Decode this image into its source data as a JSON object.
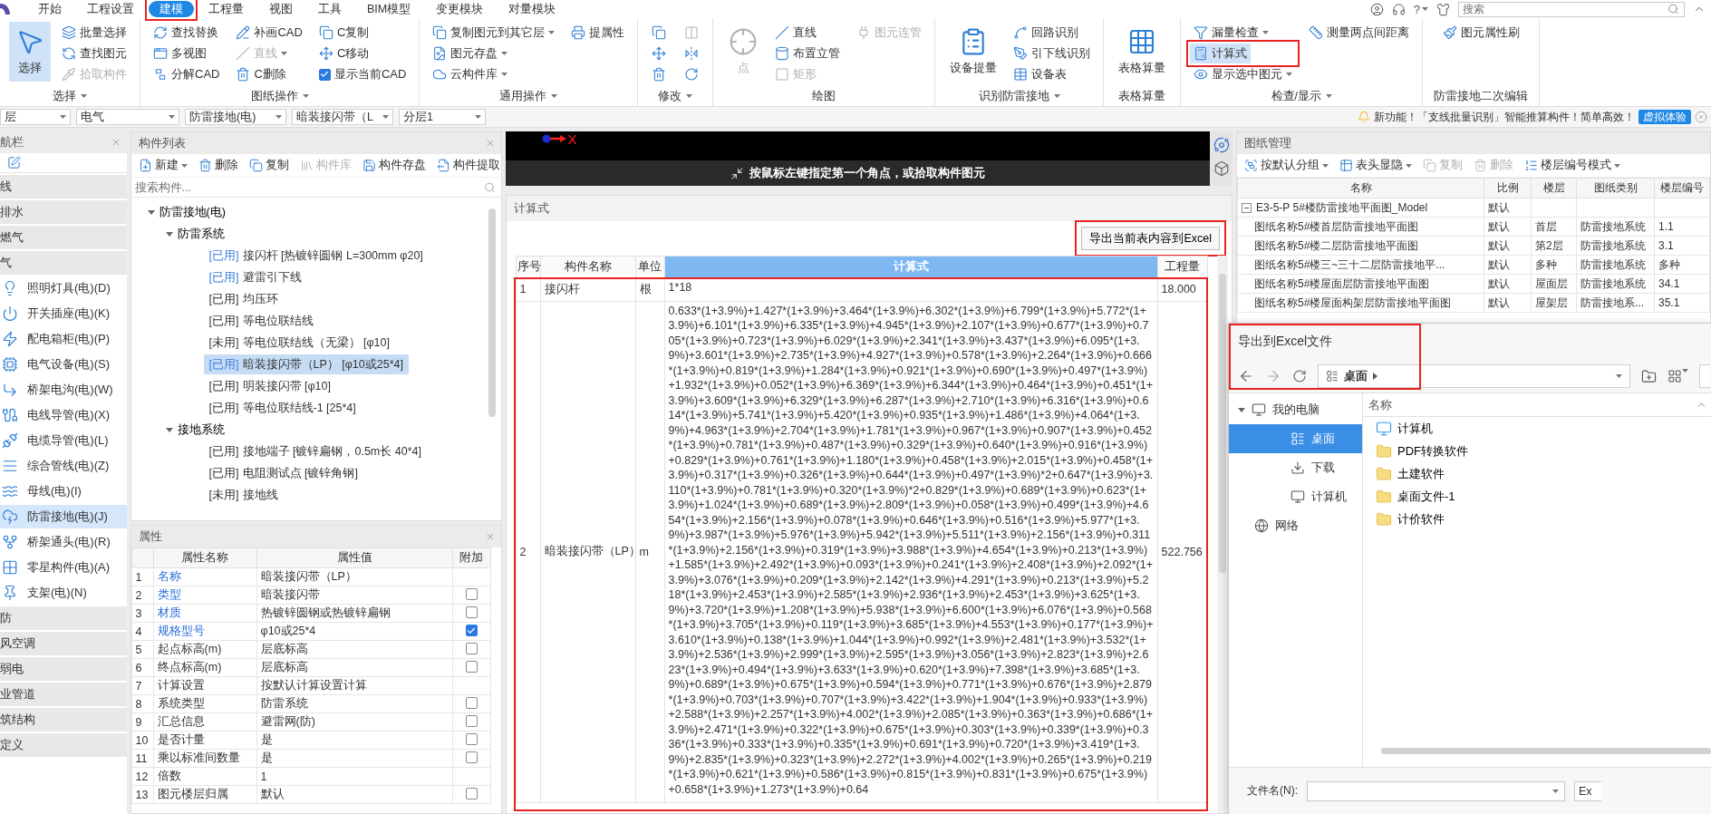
{
  "menu_bar": {
    "tabs": [
      {
        "label": "开始",
        "selected": false
      },
      {
        "label": "工程设置",
        "selected": false
      },
      {
        "label": "建模",
        "selected": true
      },
      {
        "label": "工程量",
        "selected": false
      },
      {
        "label": "视图",
        "selected": false
      },
      {
        "label": "工具",
        "selected": false
      },
      {
        "label": "BIM模型",
        "selected": false
      },
      {
        "label": "变更模块",
        "selected": false
      },
      {
        "label": "对量模块",
        "selected": false
      }
    ],
    "help": "?",
    "search": {
      "placeholder": "搜索"
    }
  },
  "ribbon": {
    "groups": [
      {
        "label": "选择",
        "menu": true,
        "items": [
          {
            "kind": "large",
            "label": "选择",
            "disabled": false,
            "dropdown": false,
            "active": true
          },
          {
            "kind": "small",
            "label": "批量选择",
            "disabled": false,
            "dropdown": false,
            "active": false
          },
          {
            "kind": "small",
            "label": "查找图元",
            "disabled": false,
            "dropdown": false,
            "active": false
          },
          {
            "kind": "small",
            "label": "拾取构件",
            "disabled": true,
            "dropdown": false,
            "active": false
          }
        ]
      },
      {
        "label": "图纸操作",
        "menu": true,
        "items": [
          {
            "kind": "small",
            "label": "查找替换",
            "disabled": false,
            "dropdown": false,
            "active": false
          },
          {
            "kind": "small",
            "label": "多视图",
            "disabled": false,
            "dropdown": false,
            "active": false
          },
          {
            "kind": "small",
            "label": "分解CAD",
            "disabled": false,
            "dropdown": false,
            "active": false
          },
          {
            "kind": "small",
            "label": "补画CAD",
            "disabled": false,
            "dropdown": false,
            "active": false
          },
          {
            "kind": "small",
            "label": "直线",
            "disabled": true,
            "dropdown": true,
            "active": false
          },
          {
            "kind": "small",
            "label": "C删除",
            "disabled": false,
            "dropdown": false,
            "active": false
          },
          {
            "kind": "small",
            "label": "C复制",
            "disabled": false,
            "dropdown": false,
            "active": false
          },
          {
            "kind": "small",
            "label": "C移动",
            "disabled": false,
            "dropdown": false,
            "active": false
          },
          {
            "kind": "check",
            "label": "显示当前CAD",
            "checked": true,
            "disabled": false,
            "dropdown": false,
            "active": false
          }
        ]
      },
      {
        "label": "通用操作",
        "menu": true,
        "items": [
          {
            "kind": "small",
            "label": "复制图元到其它层",
            "disabled": false,
            "dropdown": true,
            "active": false
          },
          {
            "kind": "small",
            "label": "图元存盘",
            "disabled": false,
            "dropdown": true,
            "active": false
          },
          {
            "kind": "small",
            "label": "云构件库",
            "disabled": false,
            "dropdown": true,
            "active": false
          },
          {
            "kind": "small",
            "label": "提属性",
            "disabled": false,
            "dropdown": false,
            "active": false
          }
        ]
      },
      {
        "label": "修改",
        "menu": true,
        "items": [
          {
            "kind": "icon",
            "disabled": false,
            "dropdown": false,
            "active": false
          },
          {
            "kind": "icon",
            "disabled": false,
            "dropdown": false,
            "active": false
          },
          {
            "kind": "icon",
            "disabled": false,
            "dropdown": false,
            "active": false
          },
          {
            "kind": "icon",
            "disabled": true,
            "dropdown": false,
            "active": false
          },
          {
            "kind": "icon",
            "disabled": false,
            "dropdown": false,
            "active": false
          },
          {
            "kind": "icon",
            "disabled": false,
            "dropdown": false,
            "active": false
          }
        ]
      },
      {
        "label": "绘图",
        "menu": false,
        "items": [
          {
            "kind": "large",
            "label": "点",
            "disabled": true,
            "dropdown": false,
            "active": false
          },
          {
            "kind": "small",
            "label": "直线",
            "disabled": false,
            "dropdown": false,
            "active": false
          },
          {
            "kind": "small",
            "label": "布置立管",
            "disabled": false,
            "dropdown": false,
            "active": false
          },
          {
            "kind": "small",
            "label": "矩形",
            "disabled": true,
            "dropdown": false,
            "active": false
          },
          {
            "kind": "small",
            "label": "图元连管",
            "disabled": true,
            "dropdown": false,
            "active": false
          }
        ]
      },
      {
        "label": "识别防雷接地",
        "menu": true,
        "items": [
          {
            "kind": "large",
            "label": "设备提量",
            "disabled": false,
            "dropdown": false,
            "active": false
          },
          {
            "kind": "small",
            "label": "回路识别",
            "disabled": false,
            "dropdown": false,
            "active": false
          },
          {
            "kind": "small",
            "label": "引下线识别",
            "disabled": false,
            "dropdown": false,
            "active": false
          },
          {
            "kind": "small",
            "label": "设备表",
            "disabled": false,
            "dropdown": false,
            "active": false
          }
        ]
      },
      {
        "label": "表格算量",
        "menu": false,
        "items": [
          {
            "kind": "large",
            "label": "表格算量",
            "disabled": false,
            "dropdown": false,
            "active": false
          }
        ]
      },
      {
        "label": "检查/显示",
        "menu": true,
        "items": [
          {
            "kind": "small",
            "label": "漏量检查",
            "disabled": false,
            "dropdown": true,
            "active": false
          },
          {
            "kind": "small",
            "label": "计算式",
            "disabled": false,
            "dropdown": false,
            "active": true
          },
          {
            "kind": "small",
            "label": "显示选中图元",
            "disabled": false,
            "dropdown": true,
            "active": false
          },
          {
            "kind": "small",
            "label": "测量两点间距离",
            "disabled": false,
            "dropdown": false,
            "active": false
          }
        ]
      },
      {
        "label": "防雷接地二次编辑",
        "menu": false,
        "items": [
          {
            "kind": "small",
            "label": "图元属性刷",
            "disabled": false,
            "dropdown": false,
            "active": false
          }
        ]
      }
    ]
  },
  "context_bar": {
    "dropdowns": [
      "层",
      "电气",
      "防雷接地(电)",
      "暗装接闪带（L",
      "分层1"
    ],
    "notice": "新功能！「支线批量识别」智能推算构件！简单高效！",
    "notice_button": "虚拟体验"
  },
  "nav_panel": {
    "title": "航栏",
    "items": [
      {
        "kind": "category",
        "label": "线",
        "selected": false
      },
      {
        "kind": "category",
        "label": "排水",
        "selected": false
      },
      {
        "kind": "category",
        "label": "燃气",
        "selected": false
      },
      {
        "kind": "category",
        "label": "气",
        "selected": false
      },
      {
        "kind": "item",
        "label": "照明灯具(电)(D)",
        "selected": false
      },
      {
        "kind": "item",
        "label": "开关插座(电)(K)",
        "selected": false
      },
      {
        "kind": "item",
        "label": "配电箱柜(电)(P)",
        "selected": false
      },
      {
        "kind": "item",
        "label": "电气设备(电)(S)",
        "selected": false
      },
      {
        "kind": "item",
        "label": "桥架电沟(电)(W)",
        "selected": false
      },
      {
        "kind": "item",
        "label": "电线导管(电)(X)",
        "selected": false
      },
      {
        "kind": "item",
        "label": "电缆导管(电)(L)",
        "selected": false
      },
      {
        "kind": "item",
        "label": "综合管线(电)(Z)",
        "selected": false
      },
      {
        "kind": "item",
        "label": "母线(电)(I)",
        "selected": false
      },
      {
        "kind": "item",
        "label": "防雷接地(电)(J)",
        "selected": true
      },
      {
        "kind": "item",
        "label": "桥架通头(电)(R)",
        "selected": false
      },
      {
        "kind": "item",
        "label": "零星构件(电)(A)",
        "selected": false
      },
      {
        "kind": "item",
        "label": "支架(电)(N)",
        "selected": false
      },
      {
        "kind": "category",
        "label": "防",
        "selected": false
      },
      {
        "kind": "category",
        "label": "风空调",
        "selected": false
      },
      {
        "kind": "category",
        "label": "弱电",
        "selected": false
      },
      {
        "kind": "category",
        "label": "业管道",
        "selected": false
      },
      {
        "kind": "category",
        "label": "筑结构",
        "selected": false
      },
      {
        "kind": "category",
        "label": "定义",
        "selected": false
      }
    ]
  },
  "component_list": {
    "title": "构件列表",
    "toolbar": [
      {
        "label": "新建",
        "disabled": false,
        "dropdown": true
      },
      {
        "label": "删除",
        "disabled": false,
        "dropdown": false
      },
      {
        "label": "复制",
        "disabled": false,
        "dropdown": false
      },
      {
        "label": "构件库",
        "disabled": true,
        "dropdown": false
      },
      {
        "label": "构件存盘",
        "disabled": false,
        "dropdown": false
      },
      {
        "label": "构件提取",
        "disabled": false,
        "dropdown": false
      }
    ],
    "search": {
      "placeholder": "搜索构件..."
    },
    "tree": [
      {
        "label": "防雷接地(电)",
        "expanded": true,
        "children": [
          {
            "label": "防雷系统",
            "expanded": true,
            "children": [
              {
                "tag": "[已用]",
                "label": "接闪杆 [热镀锌圆钢 L=300mm φ20]",
                "color": "#3b7ddd",
                "selected": false
              },
              {
                "tag": "[已用]",
                "label": "避雷引下线",
                "color": "#3b7ddd",
                "selected": false
              },
              {
                "tag": "[已用]",
                "label": "均压环",
                "color": "#333333",
                "selected": false
              },
              {
                "tag": "[已用]",
                "label": "等电位联结线",
                "color": "#333333",
                "selected": false
              },
              {
                "tag": "[未用]",
                "label": "等电位联结线（无梁） [φ10]",
                "color": "#333333",
                "selected": false
              },
              {
                "tag": "[已用]",
                "label": "暗装接闪带（LP） [φ10或25*4]",
                "color": "#3b7ddd",
                "selected": true
              },
              {
                "tag": "[已用]",
                "label": "明装接闪带 [φ10]",
                "color": "#333333",
                "selected": false
              },
              {
                "tag": "[已用]",
                "label": "等电位联结线-1 [25*4]",
                "color": "#333333",
                "selected": false
              }
            ]
          },
          {
            "label": "接地系统",
            "expanded": true,
            "children": [
              {
                "tag": "[已用]",
                "label": "接地端子 [镀锌扁钢，0.5m长 40*4]",
                "color": "#333333",
                "selected": false
              },
              {
                "tag": "[已用]",
                "label": "电阻测试点 [镀锌角钢]",
                "color": "#333333",
                "selected": false
              },
              {
                "tag": "[未用]",
                "label": "接地线",
                "color": "#333333",
                "selected": false
              }
            ]
          }
        ]
      }
    ]
  },
  "properties": {
    "title": "属性",
    "columns": [
      "属性名称",
      "属性值",
      "附加"
    ],
    "rows": [
      {
        "index": "1",
        "name": "名称",
        "value": "暗装接闪带（LP）",
        "highlighted": true,
        "kind": "plain"
      },
      {
        "index": "2",
        "name": "类型",
        "value": "暗装接闪带",
        "highlighted": true,
        "kind": "check",
        "checked": false
      },
      {
        "index": "3",
        "name": "材质",
        "value": "热镀锌圆钢或热镀锌扁钢",
        "highlighted": true,
        "kind": "check",
        "checked": false
      },
      {
        "index": "4",
        "name": "规格型号",
        "value": "φ10或25*4",
        "highlighted": true,
        "kind": "check",
        "checked": true
      },
      {
        "index": "5",
        "name": "起点标高(m)",
        "value": "层底标高",
        "highlighted": false,
        "kind": "check",
        "checked": false
      },
      {
        "index": "6",
        "name": "终点标高(m)",
        "value": "层底标高",
        "highlighted": false,
        "kind": "check",
        "checked": false
      },
      {
        "index": "7",
        "name": "计算设置",
        "value": "按默认计算设置计算",
        "highlighted": false,
        "kind": "plain"
      },
      {
        "index": "8",
        "name": "系统类型",
        "value": "防雷系统",
        "highlighted": false,
        "kind": "check",
        "checked": false
      },
      {
        "index": "9",
        "name": "汇总信息",
        "value": "避雷网(防)",
        "highlighted": false,
        "kind": "check",
        "checked": false
      },
      {
        "index": "10",
        "name": "是否计量",
        "value": "是",
        "highlighted": false,
        "kind": "check",
        "checked": false
      },
      {
        "index": "11",
        "name": "乘以标准间数量",
        "value": "是",
        "highlighted": false,
        "kind": "check",
        "checked": false
      },
      {
        "index": "12",
        "name": "倍数",
        "value": "1",
        "highlighted": false,
        "kind": "plain"
      },
      {
        "index": "13",
        "name": "图元楼层归属",
        "value": "默认",
        "highlighted": false,
        "kind": "check",
        "checked": false
      }
    ]
  },
  "viewport": {
    "axis_label": "X",
    "hint": "按鼠标左键指定第一个角点，或拾取构件图元"
  },
  "formula_panel": {
    "title": "计算式",
    "export_button": "导出当前表内容到Excel",
    "columns": [
      {
        "label": "序号",
        "selected": false
      },
      {
        "label": "构件名称",
        "selected": false
      },
      {
        "label": "单位",
        "selected": false
      },
      {
        "label": "计算式",
        "selected": true
      },
      {
        "label": "工程量",
        "selected": false
      }
    ],
    "rows": [
      {
        "index": "1",
        "name": "接闪杆",
        "unit": "根",
        "formula": "1*18",
        "quantity": "18.000"
      },
      {
        "index": "2",
        "name": "暗装接闪带（LP）",
        "unit": "m",
        "formula": "0.633*(1+3.9%)+1.427*(1+3.9%)+3.464*(1+3.9%)+6.302*(1+3.9%)+6.799*(1+3.9%)+5.772*(1+3.9%)+6.101*(1+3.9%)+6.335*(1+3.9%)+4.945*(1+3.9%)+2.107*(1+3.9%)+0.677*(1+3.9%)+0.705*(1+3.9%)+0.723*(1+3.9%)+6.029*(1+3.9%)+2.341*(1+3.9%)+3.437*(1+3.9%)+6.095*(1+3.9%)+3.601*(1+3.9%)+2.735*(1+3.9%)+4.927*(1+3.9%)+0.578*(1+3.9%)+2.264*(1+3.9%)+0.666*(1+3.9%)+0.819*(1+3.9%)+1.284*(1+3.9%)+0.921*(1+3.9%)+0.690*(1+3.9%)+0.497*(1+3.9%)+1.932*(1+3.9%)+0.052*(1+3.9%)+6.369*(1+3.9%)+6.344*(1+3.9%)+0.464*(1+3.9%)+0.451*(1+3.9%)+3.609*(1+3.9%)+6.329*(1+3.9%)+6.287*(1+3.9%)+2.710*(1+3.9%)+6.316*(1+3.9%)+0.614*(1+3.9%)+5.741*(1+3.9%)+5.420*(1+3.9%)+0.935*(1+3.9%)+1.486*(1+3.9%)+4.064*(1+3.9%)+4.963*(1+3.9%)+2.704*(1+3.9%)+1.781*(1+3.9%)+0.967*(1+3.9%)+0.907*(1+3.9%)+0.452*(1+3.9%)+0.781*(1+3.9%)+0.487*(1+3.9%)+0.329*(1+3.9%)+0.640*(1+3.9%)+0.916*(1+3.9%)+0.829*(1+3.9%)+0.761*(1+3.9%)+1.180*(1+3.9%)+0.458*(1+3.9%)+2.015*(1+3.9%)+0.458*(1+3.9%)+0.317*(1+3.9%)+0.326*(1+3.9%)+0.644*(1+3.9%)+0.497*(1+3.9%)*2+0.647*(1+3.9%)+3.110*(1+3.9%)+0.781*(1+3.9%)+0.320*(1+3.9%)*2+0.829*(1+3.9%)+0.689*(1+3.9%)+0.623*(1+3.9%)+1.024*(1+3.9%)+0.689*(1+3.9%)+2.809*(1+3.9%)+0.058*(1+3.9%)+0.499*(1+3.9%)+4.654*(1+3.9%)+2.156*(1+3.9%)+0.078*(1+3.9%)+0.646*(1+3.9%)+0.516*(1+3.9%)+5.977*(1+3.9%)+3.987*(1+3.9%)+5.976*(1+3.9%)+5.942*(1+3.9%)+5.511*(1+3.9%)+2.156*(1+3.9%)+0.311*(1+3.9%)+2.156*(1+3.9%)+0.319*(1+3.9%)+3.988*(1+3.9%)+4.654*(1+3.9%)+0.213*(1+3.9%)+1.585*(1+3.9%)+2.492*(1+3.9%)+0.093*(1+3.9%)+0.241*(1+3.9%)+2.408*(1+3.9%)+2.092*(1+3.9%)+3.076*(1+3.9%)+0.209*(1+3.9%)+2.142*(1+3.9%)+4.291*(1+3.9%)+0.213*(1+3.9%)+5.218*(1+3.9%)+2.453*(1+3.9%)+2.585*(1+3.9%)+2.936*(1+3.9%)+2.453*(1+3.9%)+3.625*(1+3.9%)+3.720*(1+3.9%)+1.208*(1+3.9%)+5.938*(1+3.9%)+6.600*(1+3.9%)+6.076*(1+3.9%)+0.568*(1+3.9%)+3.705*(1+3.9%)+0.119*(1+3.9%)+3.685*(1+3.9%)+4.553*(1+3.9%)+0.177*(1+3.9%)+3.610*(1+3.9%)+0.138*(1+3.9%)+1.044*(1+3.9%)+0.992*(1+3.9%)+2.481*(1+3.9%)+3.532*(1+3.9%)+2.536*(1+3.9%)+2.999*(1+3.9%)+2.595*(1+3.9%)+3.056*(1+3.9%)+2.823*(1+3.9%)+2.623*(1+3.9%)+0.494*(1+3.9%)+3.633*(1+3.9%)+0.620*(1+3.9%)+7.398*(1+3.9%)+3.685*(1+3.9%)+0.689*(1+3.9%)+0.675*(1+3.9%)+0.594*(1+3.9%)+0.771*(1+3.9%)+0.676*(1+3.9%)+2.879*(1+3.9%)+0.703*(1+3.9%)+0.707*(1+3.9%)+3.422*(1+3.9%)+1.904*(1+3.9%)+0.933*(1+3.9%)+2.588*(1+3.9%)+2.257*(1+3.9%)+4.002*(1+3.9%)+2.085*(1+3.9%)+0.363*(1+3.9%)+0.686*(1+3.9%)+2.471*(1+3.9%)+0.322*(1+3.9%)+0.675*(1+3.9%)+0.303*(1+3.9%)+0.339*(1+3.9%)+0.336*(1+3.9%)+0.333*(1+3.9%)+0.335*(1+3.9%)+0.691*(1+3.9%)+0.720*(1+3.9%)+3.419*(1+3.9%)+2.835*(1+3.9%)+0.323*(1+3.9%)+2.272*(1+3.9%)+4.002*(1+3.9%)+0.265*(1+3.9%)+0.219*(1+3.9%)+0.621*(1+3.9%)+0.586*(1+3.9%)+0.815*(1+3.9%)+0.831*(1+3.9%)+0.675*(1+3.9%)+0.658*(1+3.9%)+1.273*(1+3.9%)+0.64",
        "quantity": "522.756"
      }
    ]
  },
  "drawing_manager": {
    "title": "图纸管理",
    "toolbar": [
      {
        "label": "按默认分组",
        "disabled": false,
        "dropdown": true
      },
      {
        "label": "表头显隐",
        "disabled": false,
        "dropdown": true
      },
      {
        "label": "复制",
        "disabled": true,
        "dropdown": false
      },
      {
        "label": "删除",
        "disabled": true,
        "dropdown": false
      },
      {
        "label": "楼层编号模式",
        "disabled": false,
        "dropdown": true
      }
    ],
    "columns": [
      "名称",
      "比例",
      "楼层",
      "图纸类别",
      "楼层编号"
    ],
    "rows": [
      {
        "name": "E3-5-P 5#楼防雷接地平面图_Model",
        "scale": "默认",
        "expanded": true,
        "children": [
          {
            "name": "图纸名称5#楼首层防雷接地平面图",
            "scale": "默认",
            "floor": "首层",
            "category": "防雷接地系统",
            "floor_code": "1.1"
          },
          {
            "name": "图纸名称5#楼二层防雷接地平面图",
            "scale": "默认",
            "floor": "第2层",
            "category": "防雷接地系统",
            "floor_code": "3.1"
          },
          {
            "name": "图纸名称5#楼三~三十二层防雷接地平...",
            "scale": "默认",
            "floor": "多种",
            "category": "防雷接地系统",
            "floor_code": "多种"
          },
          {
            "name": "图纸名称5#楼屋面层防雷接地平面图",
            "scale": "默认",
            "floor": "屋面层",
            "category": "防雷接地系统",
            "floor_code": "34.1"
          },
          {
            "name": "图纸名称5#楼屋面构架层防雷接地平面图",
            "scale": "默认",
            "floor": "屋架层",
            "category": "防雷接地系...",
            "floor_code": "35.1"
          }
        ]
      }
    ]
  },
  "export_dialog": {
    "title": "导出到Excel文件",
    "path": "桌面",
    "sidebar": [
      {
        "label": "我的电脑",
        "expanded": true,
        "selected": false,
        "children": [
          {
            "label": "桌面",
            "selected": true
          },
          {
            "label": "下载",
            "selected": false
          },
          {
            "label": "计算机",
            "selected": false
          }
        ]
      },
      {
        "label": "网络",
        "selected": false
      }
    ],
    "list_header": "名称",
    "files": [
      {
        "kind": "computer",
        "label": "计算机"
      },
      {
        "kind": "folder",
        "label": "PDF转换软件"
      },
      {
        "kind": "folder",
        "label": "土建软件"
      },
      {
        "kind": "folder",
        "label": "桌面文件-1"
      },
      {
        "kind": "folder",
        "label": "计价软件"
      }
    ],
    "filename_label": "文件名(N):",
    "filetype": "Ex"
  }
}
